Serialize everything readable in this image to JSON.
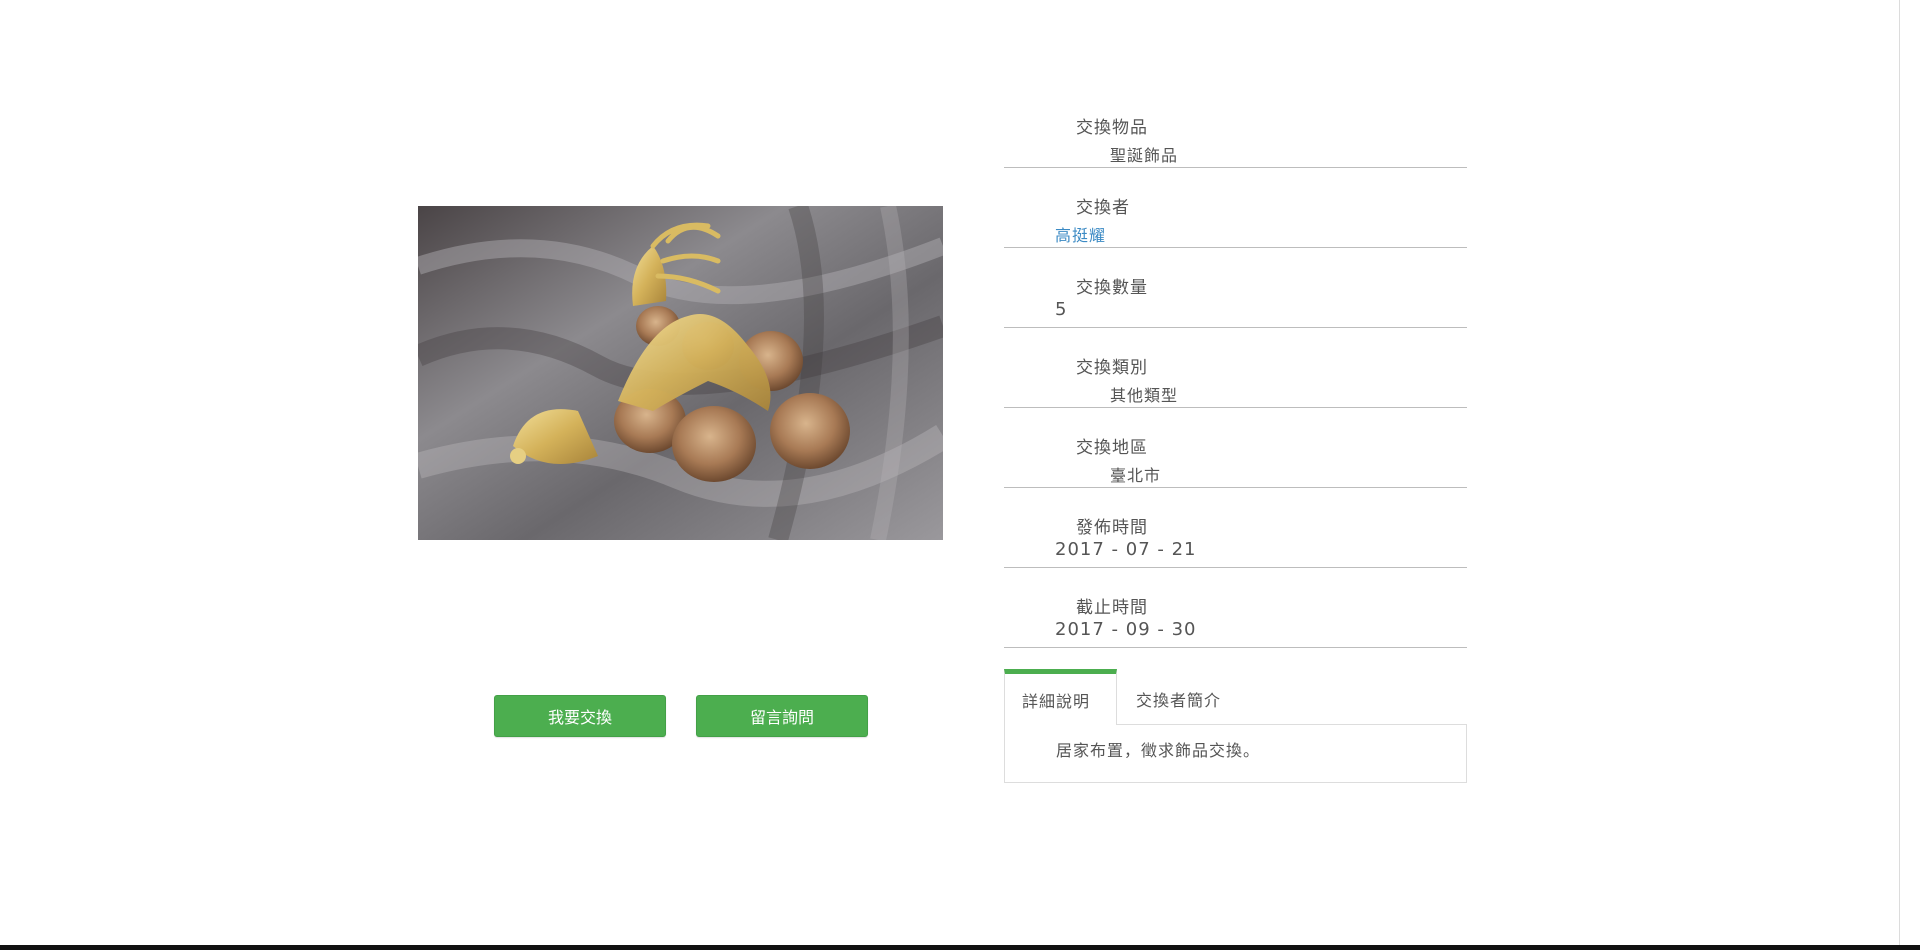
{
  "product": {
    "image_alt": "聖誕飾品"
  },
  "actions": {
    "exchange_label": "我要交換",
    "ask_label": "留言詢問"
  },
  "details": {
    "item": {
      "label": "交換物品",
      "value": "聖誕飾品"
    },
    "owner": {
      "label": "交換者",
      "value": "高挺耀"
    },
    "quantity": {
      "label": "交換數量",
      "value": "5"
    },
    "category": {
      "label": "交換類別",
      "value": "其他類型"
    },
    "region": {
      "label": "交換地區",
      "value": "臺北市"
    },
    "published": {
      "label": "發佈時間",
      "value": "2017 - 07 - 21"
    },
    "deadline": {
      "label": "截止時間",
      "value": "2017 - 09 - 30"
    }
  },
  "tabs": {
    "detail_label": "詳細說明",
    "profile_label": "交換者簡介",
    "detail_content": "居家布置，徵求飾品交換。"
  },
  "colors": {
    "accent": "#4cae4f",
    "link": "#3b8ac4",
    "text": "#555555",
    "divider": "#bdbdbd"
  }
}
